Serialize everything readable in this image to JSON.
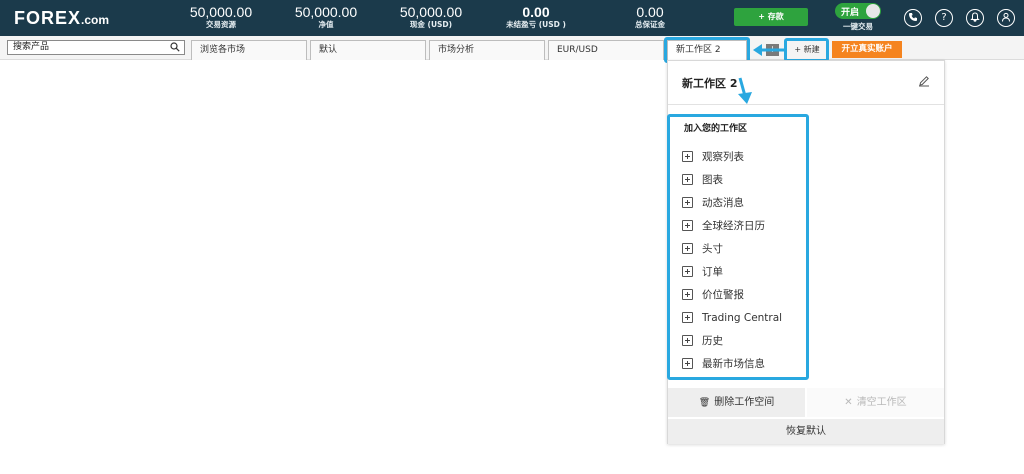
{
  "header": {
    "logo_main": "FOREX",
    "logo_suffix": ".com",
    "stats": [
      {
        "value": "50,000.00",
        "label": "交易资源"
      },
      {
        "value": "50,000.00",
        "label": "净值"
      },
      {
        "value": "50,000.00",
        "label": "现金 (USD)"
      },
      {
        "value": "0.00",
        "label": "未结盈亏 (USD )"
      },
      {
        "value": "0.00",
        "label": "总保证金"
      }
    ],
    "deposit_label": "+ 存款",
    "toggle_state": "开启",
    "toggle_label": "一键交易",
    "icons": [
      "phone-icon",
      "help-icon",
      "bell-icon",
      "account-icon"
    ]
  },
  "toolbar": {
    "search_placeholder": "搜索产品",
    "tabs": [
      "浏览各市场",
      "默认",
      "市场分析",
      "EUR/USD",
      "新工作区 2"
    ],
    "new_label": "+ 新建",
    "real_account_label": "开立真实账户"
  },
  "panel": {
    "title": "新工作区 2",
    "add_title": "加入您的工作区",
    "items": [
      "观察列表",
      "图表",
      "动态消息",
      "全球经济日历",
      "头寸",
      "订单",
      "价位警报",
      "Trading Central",
      "历史",
      "最新市场信息"
    ],
    "delete_label": "删除工作空间",
    "clear_label": "清空工作区",
    "restore_label": "恢复默认"
  },
  "colors": {
    "header_bg": "#1b3a4b",
    "highlight": "#29a8e0",
    "deposit": "#2ea33e",
    "real_account": "#f5841f"
  }
}
